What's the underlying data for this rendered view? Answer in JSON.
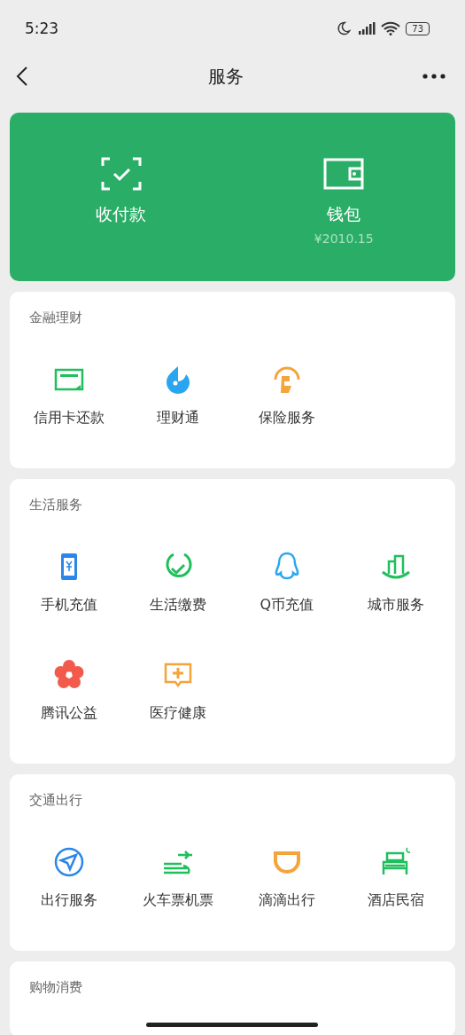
{
  "status_bar": {
    "time": "5:23",
    "battery": "73"
  },
  "nav": {
    "title": "服务"
  },
  "wallet": [
    {
      "kind": "scan",
      "label": "收付款"
    },
    {
      "kind": "wallet",
      "label": "钱包",
      "amount": "¥2010.15"
    }
  ],
  "sections": [
    {
      "title": "金融理财",
      "items": [
        {
          "kind": "card",
          "label": "信用卡还款"
        },
        {
          "kind": "finance",
          "label": "理财通"
        },
        {
          "kind": "insurance",
          "label": "保险服务"
        }
      ]
    },
    {
      "title": "生活服务",
      "items": [
        {
          "kind": "phone",
          "label": "手机充值"
        },
        {
          "kind": "utility",
          "label": "生活缴费"
        },
        {
          "kind": "penguin",
          "label": "Q币充值"
        },
        {
          "kind": "city",
          "label": "城市服务"
        },
        {
          "kind": "flower",
          "label": "腾讯公益"
        },
        {
          "kind": "medical",
          "label": "医疗健康"
        }
      ]
    },
    {
      "title": "交通出行",
      "items": [
        {
          "kind": "compass",
          "label": "出行服务"
        },
        {
          "kind": "train",
          "label": "火车票机票"
        },
        {
          "kind": "didi",
          "label": "滴滴出行"
        },
        {
          "kind": "hotel",
          "label": "酒店民宿"
        }
      ]
    },
    {
      "title": "购物消费"
    }
  ]
}
